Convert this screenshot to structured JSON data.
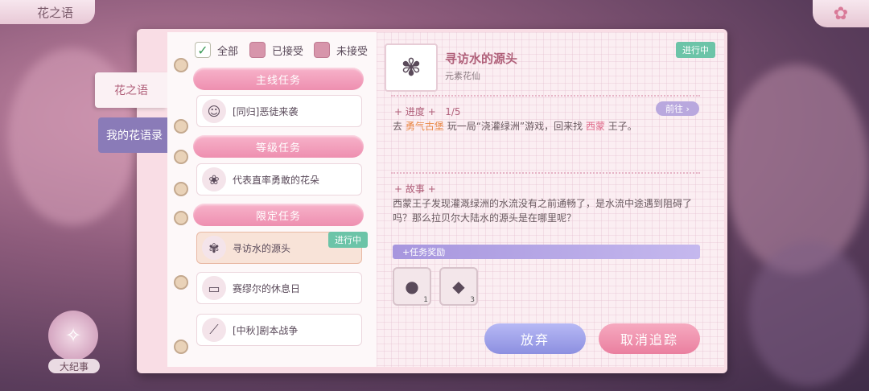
{
  "top_tab": "花之语",
  "close_icon": "flower-close-icon",
  "side_tabs": [
    "花之语",
    "我的花语录"
  ],
  "filters": [
    {
      "label": "全部",
      "checked": true
    },
    {
      "label": "已接受",
      "checked": false
    },
    {
      "label": "未接受",
      "checked": false
    }
  ],
  "sections": {
    "main": "主线任务",
    "level": "等级任务",
    "limited": "限定任务"
  },
  "tasks": [
    {
      "label": "[同归]恶徒来袭",
      "icon": "character-portrait-icon"
    },
    {
      "label": "代表直率勇敢的花朵",
      "icon": "flower-wreath-icon"
    },
    {
      "label": "寻访水的源头",
      "icon": "water-flower-icon",
      "badge": "进行中"
    },
    {
      "label": "赛缪尔的休息日",
      "icon": "paper-note-icon"
    },
    {
      "label": "[中秋]剧本战争",
      "icon": "branch-icon"
    }
  ],
  "detail": {
    "status": "进行中",
    "title": "寻访水的源头",
    "subtitle": "元素花仙",
    "progress_label": "进度",
    "progress_value": "1/5",
    "go_button": "前往",
    "progress_text_1": "去",
    "location": "勇气古堡",
    "progress_text_2": "玩一局“浇灌绿洲”游戏，回来找",
    "npc": "西蒙",
    "progress_text_3": "王子。",
    "story_label": "故事",
    "story_text": "西蒙王子发现灌溉绿洲的水流没有之前通畅了，是水流中途遇到阻碍了吗？那么拉贝尔大陆水的源头是在哪里呢？",
    "reward_label": "任务奖励",
    "rewards": [
      {
        "icon": "seed-bag-icon",
        "count": "1"
      },
      {
        "icon": "gem-icon",
        "count": "3"
      }
    ],
    "btn_giveup": "放弃",
    "btn_untrack": "取消追踪"
  },
  "chronicle_label": "大纪事"
}
